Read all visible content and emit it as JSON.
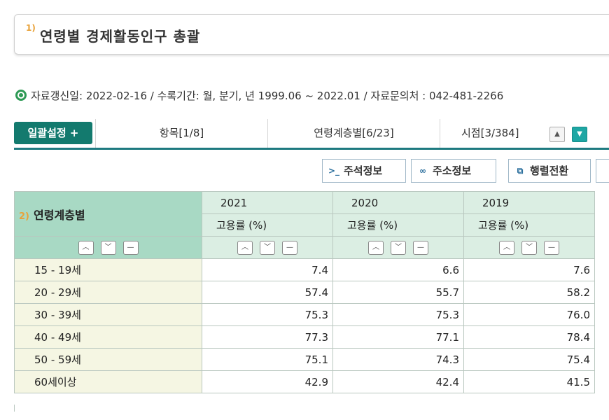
{
  "page": {
    "title_num": "1)",
    "title": "연령별 경제활동인구 총괄"
  },
  "info": {
    "text": "자료갱신일: 2022-02-16 / 수록기간: 월, 분기, 년 1999.06 ~ 2022.01 / 자료문의처 : 042-481-2266"
  },
  "tabs": {
    "bulk_label": "일괄설정 +",
    "items": [
      {
        "label": "항목[1/8]"
      },
      {
        "label": "연령계층별[6/23]"
      },
      {
        "label": "시점[3/384]"
      }
    ]
  },
  "toolbar": {
    "annotation_label": "주석정보",
    "address_label": "주소정보",
    "transpose_label": "행렬전환"
  },
  "table": {
    "row_header_num": "2)",
    "row_header": "연령계층별",
    "years": [
      "2021",
      "2020",
      "2019"
    ],
    "unit": "고용률 (%)",
    "rows": [
      {
        "label": "15 - 19세",
        "values": [
          "7.4",
          "6.6",
          "7.6"
        ]
      },
      {
        "label": "20 - 29세",
        "values": [
          "57.4",
          "55.7",
          "58.2"
        ]
      },
      {
        "label": "30 - 39세",
        "values": [
          "75.3",
          "75.3",
          "76.0"
        ]
      },
      {
        "label": "40 - 49세",
        "values": [
          "77.3",
          "77.1",
          "78.4"
        ]
      },
      {
        "label": "50 - 59세",
        "values": [
          "75.1",
          "74.3",
          "75.4"
        ]
      },
      {
        "label": "60세이상",
        "values": [
          "42.9",
          "42.4",
          "41.5"
        ]
      }
    ]
  },
  "icons": {
    "sort_asc": "chevron-up-icon",
    "sort_desc": "chevron-down-icon",
    "sort_reset": "minus-icon"
  },
  "colors": {
    "accent": "#137a6e",
    "header_dark": "#a8d9c4",
    "header_light": "#dbeee3",
    "row_label_bg": "#f5f6e3"
  }
}
